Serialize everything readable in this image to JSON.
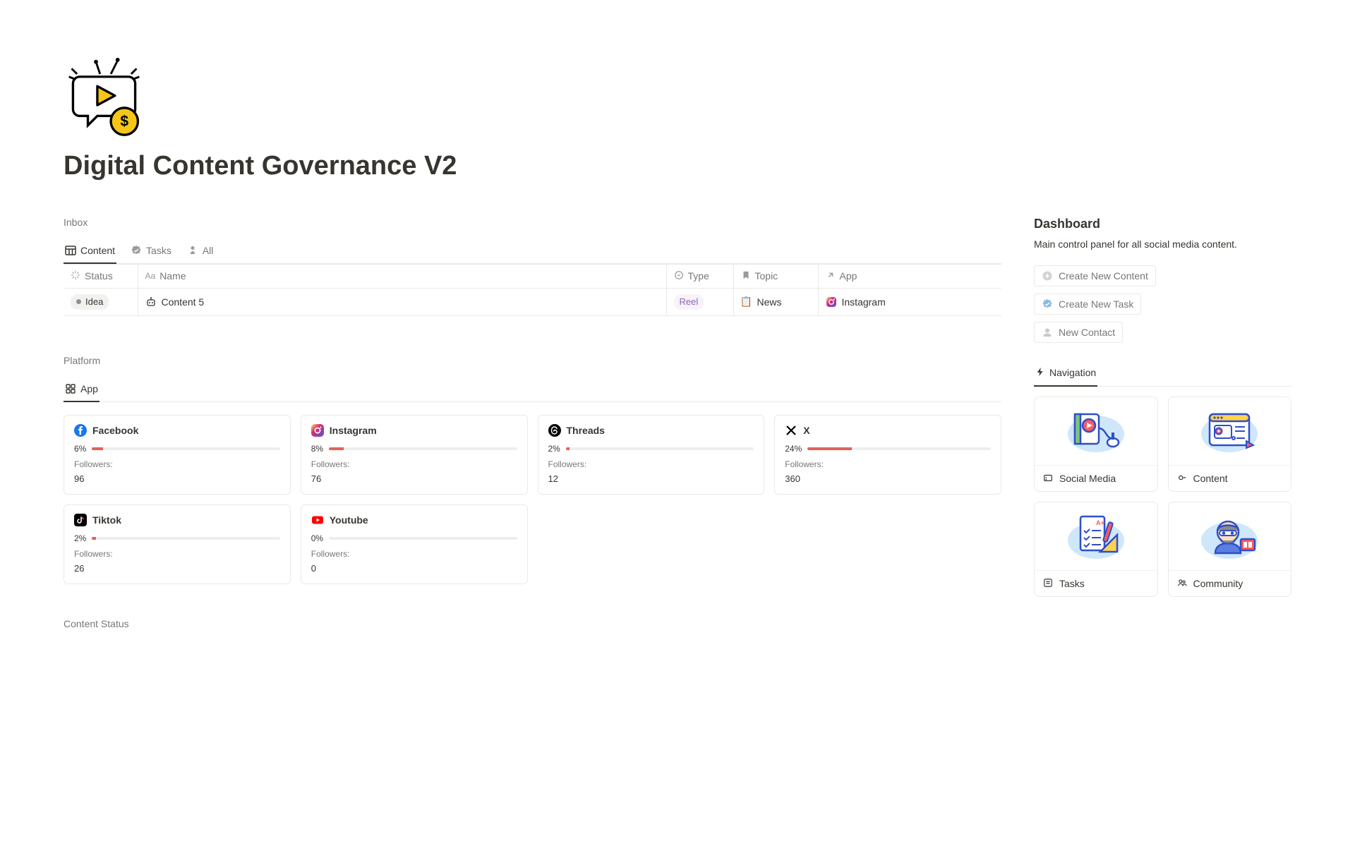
{
  "title": "Digital Content Governance V2",
  "inbox": {
    "section_label": "Inbox",
    "tabs": [
      {
        "label": "Content",
        "icon": "board-icon"
      },
      {
        "label": "Tasks",
        "icon": "check-badge-icon"
      },
      {
        "label": "All",
        "icon": "pawn-icon"
      }
    ],
    "columns": {
      "status": "Status",
      "name": "Name",
      "type": "Type",
      "topic": "Topic",
      "app": "App"
    },
    "rows": [
      {
        "status": "Idea",
        "name": "Content 5",
        "type": "Reel",
        "topic": "News",
        "topic_glyph": "📋",
        "app": "Instagram"
      }
    ]
  },
  "platform": {
    "section_label": "Platform",
    "tab_label": "App",
    "cards": [
      {
        "name": "Facebook",
        "pct": "6%",
        "followers_label": "Followers:",
        "followers": "96",
        "color": "#1877f2"
      },
      {
        "name": "Instagram",
        "pct": "8%",
        "followers_label": "Followers:",
        "followers": "76",
        "color": "#e1306c"
      },
      {
        "name": "Threads",
        "pct": "2%",
        "followers_label": "Followers:",
        "followers": "12",
        "color": "#000000"
      },
      {
        "name": "X",
        "pct": "24%",
        "followers_label": "Followers:",
        "followers": "360",
        "color": "#000000"
      },
      {
        "name": "Tiktok",
        "pct": "2%",
        "followers_label": "Followers:",
        "followers": "26",
        "color": "#000000"
      },
      {
        "name": "Youtube",
        "pct": "0%",
        "followers_label": "Followers:",
        "followers": "0",
        "color": "#ff0000"
      }
    ]
  },
  "content_status_label": "Content Status",
  "dashboard": {
    "title": "Dashboard",
    "subtitle": "Main control panel for all social media content.",
    "actions": [
      {
        "label": "Create New Content",
        "icon": "plus-circle-icon"
      },
      {
        "label": "Create New Task",
        "icon": "check-badge-icon"
      },
      {
        "label": "New Contact",
        "icon": "person-icon"
      }
    ],
    "nav_tab": "Navigation",
    "nav_cards": [
      {
        "label": "Social Media"
      },
      {
        "label": "Content"
      },
      {
        "label": "Tasks"
      },
      {
        "label": "Community"
      }
    ]
  }
}
